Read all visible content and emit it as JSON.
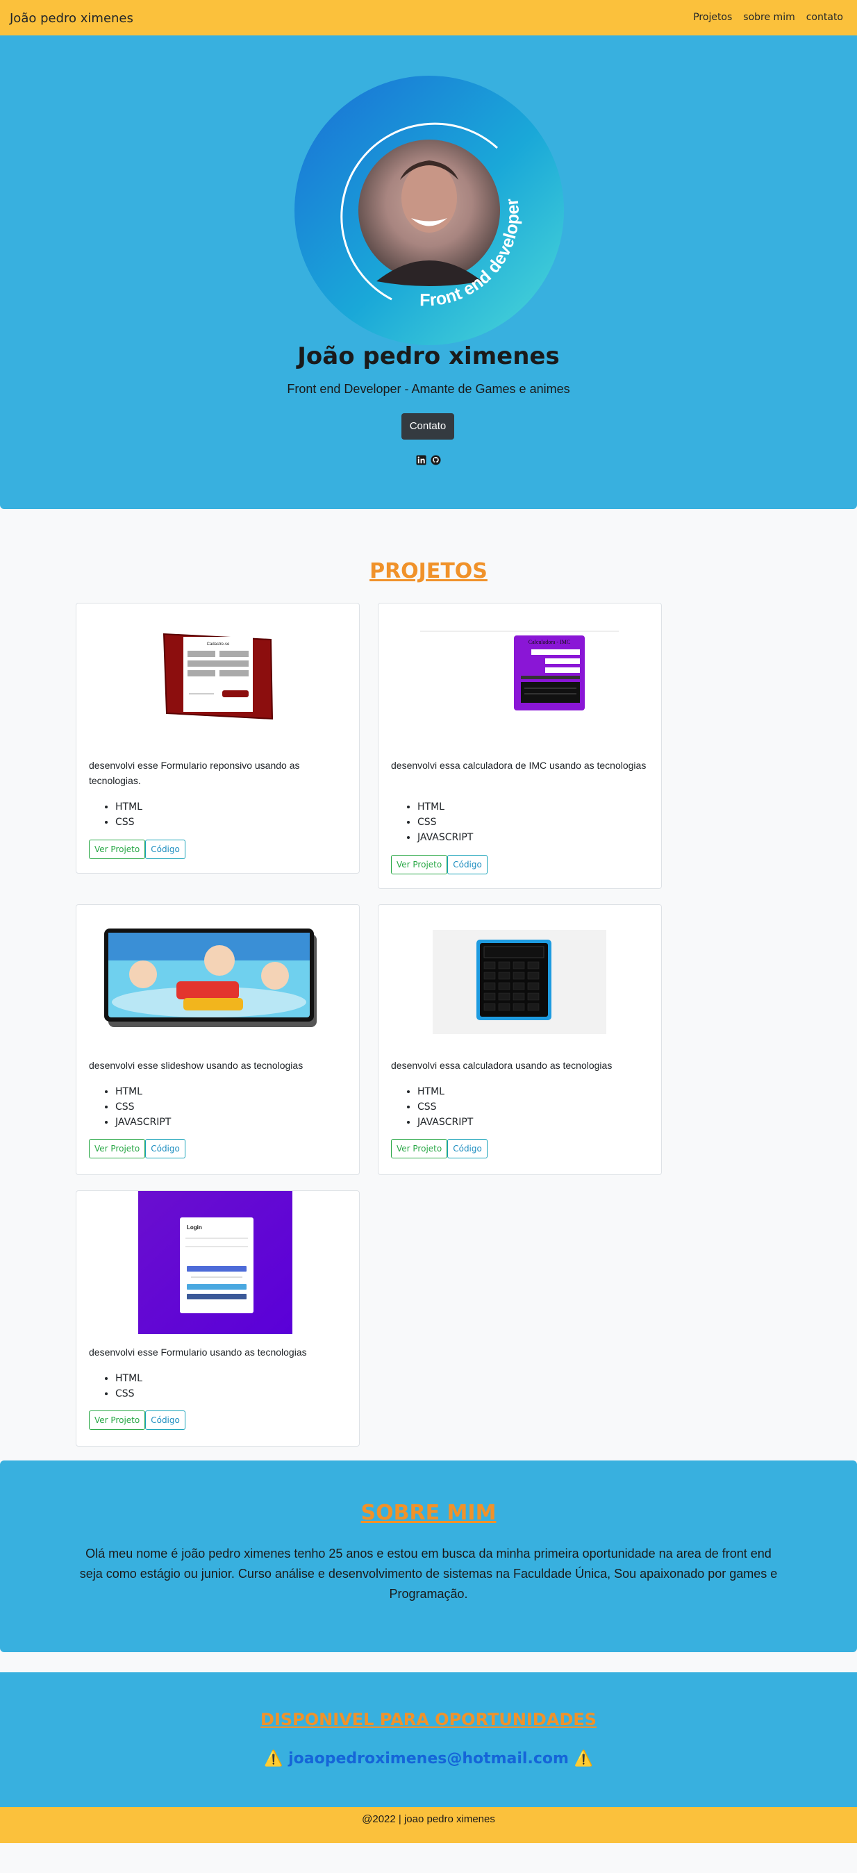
{
  "nav": {
    "brand": "João pedro ximenes",
    "links": [
      "Projetos",
      "sobre mim",
      "contato"
    ]
  },
  "hero": {
    "badge_text": "Front end developer",
    "name": "João pedro ximenes",
    "subtitle": "Front end Developer - Amante de Games e animes",
    "contact_button": "Contato",
    "social_icons": [
      "linkedin-icon",
      "github-icon"
    ]
  },
  "projects": {
    "title": "PROJETOS",
    "cards": [
      {
        "description": "desenvolvi esse Formulario reponsivo usando as tecnologias.",
        "techs": [
          "HTML",
          "CSS"
        ],
        "view_label": "Ver Projeto",
        "code_label": "Código",
        "thumb_title": "Cadastre-se"
      },
      {
        "description": "desenvolvi essa calculadora de IMC usando as tecnologias",
        "techs": [
          "HTML",
          "CSS",
          "JAVASCRIPT"
        ],
        "view_label": "Ver Projeto",
        "code_label": "Código",
        "thumb_title": "Calculadora - IMC"
      },
      {
        "description": "desenvolvi esse slideshow usando as tecnologias",
        "techs": [
          "HTML",
          "CSS",
          "JAVASCRIPT"
        ],
        "view_label": "Ver Projeto",
        "code_label": "Código"
      },
      {
        "description": "desenvolvi essa calculadora usando as tecnologias",
        "techs": [
          "HTML",
          "CSS",
          "JAVASCRIPT"
        ],
        "view_label": "Ver Projeto",
        "code_label": "Código"
      },
      {
        "description": "desenvolvi esse Formulario usando as tecnologias",
        "techs": [
          "HTML",
          "CSS"
        ],
        "view_label": "Ver Projeto",
        "code_label": "Código",
        "thumb_title": "Login"
      }
    ]
  },
  "about": {
    "title": "SOBRE MIM",
    "text": "Olá meu nome é joão pedro ximenes tenho 25 anos e estou em busca da minha primeira oportunidade na area de front end seja como estágio ou junior. Curso análise e desenvolvimento de sistemas na Faculdade Única, Sou apaixonado por games e Programação."
  },
  "availability": {
    "title": "DISPONIVEL PARA OPORTUNIDADES",
    "warning_icon": "⚠️",
    "email": "joaopedroximenes@hotmail.com"
  },
  "footer": {
    "text": "@2022 | joao pedro ximenes"
  },
  "colors": {
    "navbar": "#fbc13c",
    "hero": "#38b0df",
    "section_title": "#f0922a",
    "link": "#1565d8"
  }
}
